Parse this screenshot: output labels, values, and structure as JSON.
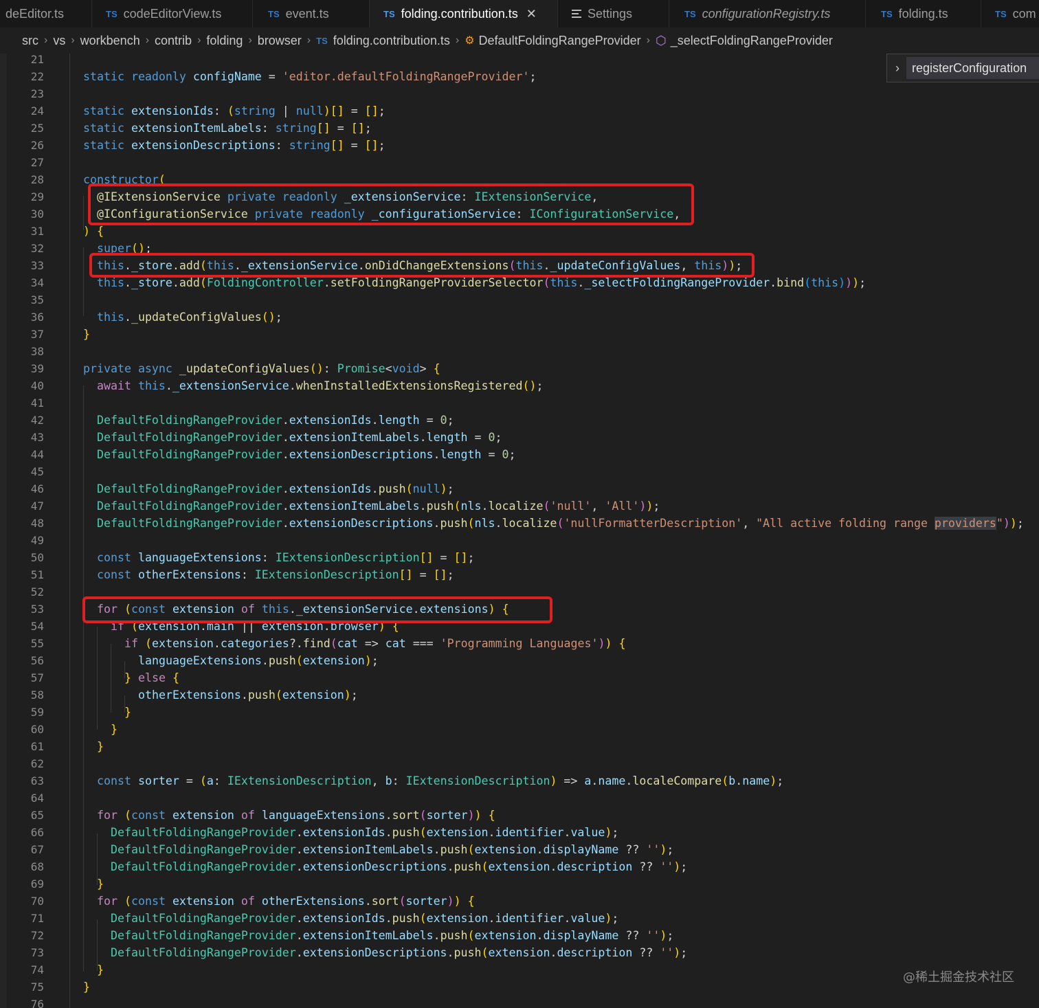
{
  "tabs": [
    {
      "label": "deEditor.ts",
      "badge": "",
      "italic": false
    },
    {
      "label": "codeEditorView.ts",
      "badge": "TS",
      "italic": false
    },
    {
      "label": "event.ts",
      "badge": "TS",
      "italic": false
    },
    {
      "label": "folding.contribution.ts",
      "badge": "TS",
      "italic": false,
      "active": true
    },
    {
      "label": "Settings",
      "badge": "",
      "italic": false
    },
    {
      "label": "configurationRegistry.ts",
      "badge": "TS",
      "italic": true
    },
    {
      "label": "folding.ts",
      "badge": "TS",
      "italic": false
    },
    {
      "label": "com",
      "badge": "TS",
      "italic": false
    }
  ],
  "breadcrumb": [
    "src",
    "vs",
    "workbench",
    "contrib",
    "folding",
    "browser",
    "folding.contribution.ts",
    "DefaultFoldingRangeProvider",
    "_selectFoldingRangeProvider"
  ],
  "sticky_widget": "registerConfiguration",
  "line_numbers": [
    "21",
    "22",
    "23",
    "24",
    "25",
    "26",
    "27",
    "28",
    "29",
    "30",
    "31",
    "32",
    "33",
    "34",
    "35",
    "36",
    "37",
    "38",
    "39",
    "40",
    "41",
    "42",
    "43",
    "44",
    "45",
    "46",
    "47",
    "48",
    "49",
    "50",
    "51",
    "52",
    "53",
    "54",
    "55",
    "56",
    "57",
    "58",
    "59",
    "60",
    "61",
    "62",
    "63",
    "64",
    "65",
    "66",
    "67",
    "68",
    "69",
    "70",
    "71",
    "72",
    "73",
    "74",
    "75",
    "76"
  ],
  "code_lines": [
    "",
    "static readonly configName = 'editor.defaultFoldingRangeProvider';",
    "",
    "static extensionIds: (string | null)[] = [];",
    "static extensionItemLabels: string[] = [];",
    "static extensionDescriptions: string[] = [];",
    "",
    "constructor(",
    "  @IExtensionService private readonly _extensionService: IExtensionService,",
    "  @IConfigurationService private readonly _configurationService: IConfigurationService,",
    ") {",
    "  super();",
    "  this._store.add(this._extensionService.onDidChangeExtensions(this._updateConfigValues, this));",
    "  this._store.add(FoldingController.setFoldingRangeProviderSelector(this._selectFoldingRangeProvider.bind(this)));",
    "",
    "  this._updateConfigValues();",
    "}",
    "",
    "private async _updateConfigValues(): Promise<void> {",
    "  await this._extensionService.whenInstalledExtensionsRegistered();",
    "",
    "  DefaultFoldingRangeProvider.extensionIds.length = 0;",
    "  DefaultFoldingRangeProvider.extensionItemLabels.length = 0;",
    "  DefaultFoldingRangeProvider.extensionDescriptions.length = 0;",
    "",
    "  DefaultFoldingRangeProvider.extensionIds.push(null);",
    "  DefaultFoldingRangeProvider.extensionItemLabels.push(nls.localize('null', 'All'));",
    "  DefaultFoldingRangeProvider.extensionDescriptions.push(nls.localize('nullFormatterDescription', \"All active folding range providers\"));",
    "",
    "  const languageExtensions: IExtensionDescription[] = [];",
    "  const otherExtensions: IExtensionDescription[] = [];",
    "",
    "  for (const extension of this._extensionService.extensions) {",
    "    if (extension.main || extension.browser) {",
    "      if (extension.categories?.find(cat => cat === 'Programming Languages')) {",
    "        languageExtensions.push(extension);",
    "      } else {",
    "        otherExtensions.push(extension);",
    "      }",
    "    }",
    "  }",
    "",
    "  const sorter = (a: IExtensionDescription, b: IExtensionDescription) => a.name.localeCompare(b.name);",
    "",
    "  for (const extension of languageExtensions.sort(sorter)) {",
    "    DefaultFoldingRangeProvider.extensionIds.push(extension.identifier.value);",
    "    DefaultFoldingRangeProvider.extensionItemLabels.push(extension.displayName ?? '');",
    "    DefaultFoldingRangeProvider.extensionDescriptions.push(extension.description ?? '');",
    "  }",
    "  for (const extension of otherExtensions.sort(sorter)) {",
    "    DefaultFoldingRangeProvider.extensionIds.push(extension.identifier.value);",
    "    DefaultFoldingRangeProvider.extensionItemLabels.push(extension.displayName ?? '');",
    "    DefaultFoldingRangeProvider.extensionDescriptions.push(extension.description ?? '');",
    "  }",
    "}",
    ""
  ],
  "watermark": "@稀土掘金技术社区",
  "colors": {
    "editor_bg": "#1f1f1f",
    "tab_bg": "#181818",
    "keyword": "#569cd6",
    "control": "#c586c0",
    "property": "#9cdcfe",
    "type": "#4ec9b0",
    "function": "#dcdcaa",
    "string": "#ce9178",
    "number": "#b5cea8",
    "annotation_box": "#e02020"
  }
}
